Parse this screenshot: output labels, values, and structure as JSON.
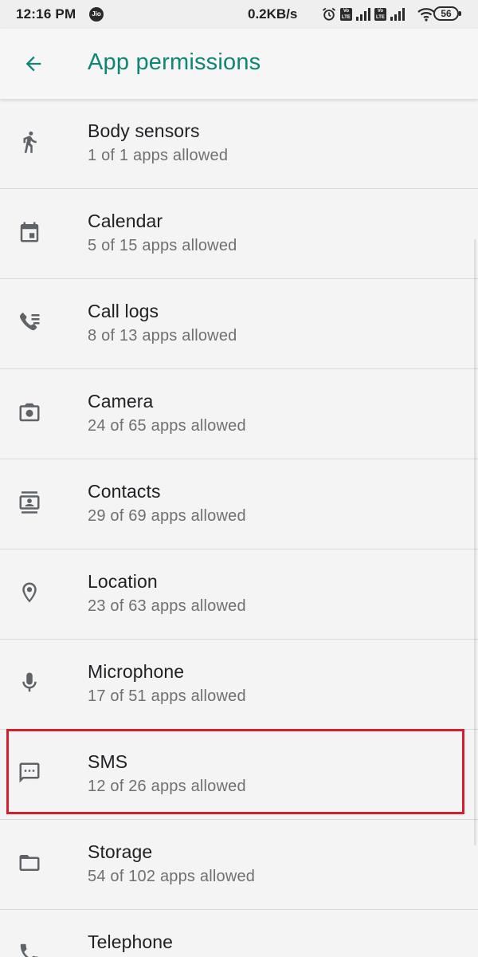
{
  "status_bar": {
    "time": "12:16 PM",
    "carrier_badge": "Jio",
    "net_speed": "0.2KB/s",
    "battery": "56",
    "icons": [
      "alarm-icon",
      "volte-icon",
      "signal-icon",
      "volte-icon",
      "signal-icon",
      "wifi-icon",
      "battery-icon"
    ]
  },
  "app_bar": {
    "title": "App permissions",
    "back_icon": "arrow-back-icon",
    "accent_color": "#0e8673"
  },
  "permissions": [
    {
      "icon": "body-sensors-icon",
      "title": "Body sensors",
      "subtitle": "1 of 1 apps allowed"
    },
    {
      "icon": "calendar-icon",
      "title": "Calendar",
      "subtitle": "5 of 15 apps allowed"
    },
    {
      "icon": "call-logs-icon",
      "title": "Call logs",
      "subtitle": "8 of 13 apps allowed"
    },
    {
      "icon": "camera-icon",
      "title": "Camera",
      "subtitle": "24 of 65 apps allowed"
    },
    {
      "icon": "contacts-icon",
      "title": "Contacts",
      "subtitle": "29 of 69 apps allowed"
    },
    {
      "icon": "location-icon",
      "title": "Location",
      "subtitle": "23 of 63 apps allowed"
    },
    {
      "icon": "microphone-icon",
      "title": "Microphone",
      "subtitle": "17 of 51 apps allowed"
    },
    {
      "icon": "sms-icon",
      "title": "SMS",
      "subtitle": "12 of 26 apps allowed",
      "highlighted": true
    },
    {
      "icon": "storage-icon",
      "title": "Storage",
      "subtitle": "54 of 102 apps allowed"
    },
    {
      "icon": "telephone-icon",
      "title": "Telephone",
      "subtitle": ""
    }
  ],
  "highlight_color": "#d3202e"
}
